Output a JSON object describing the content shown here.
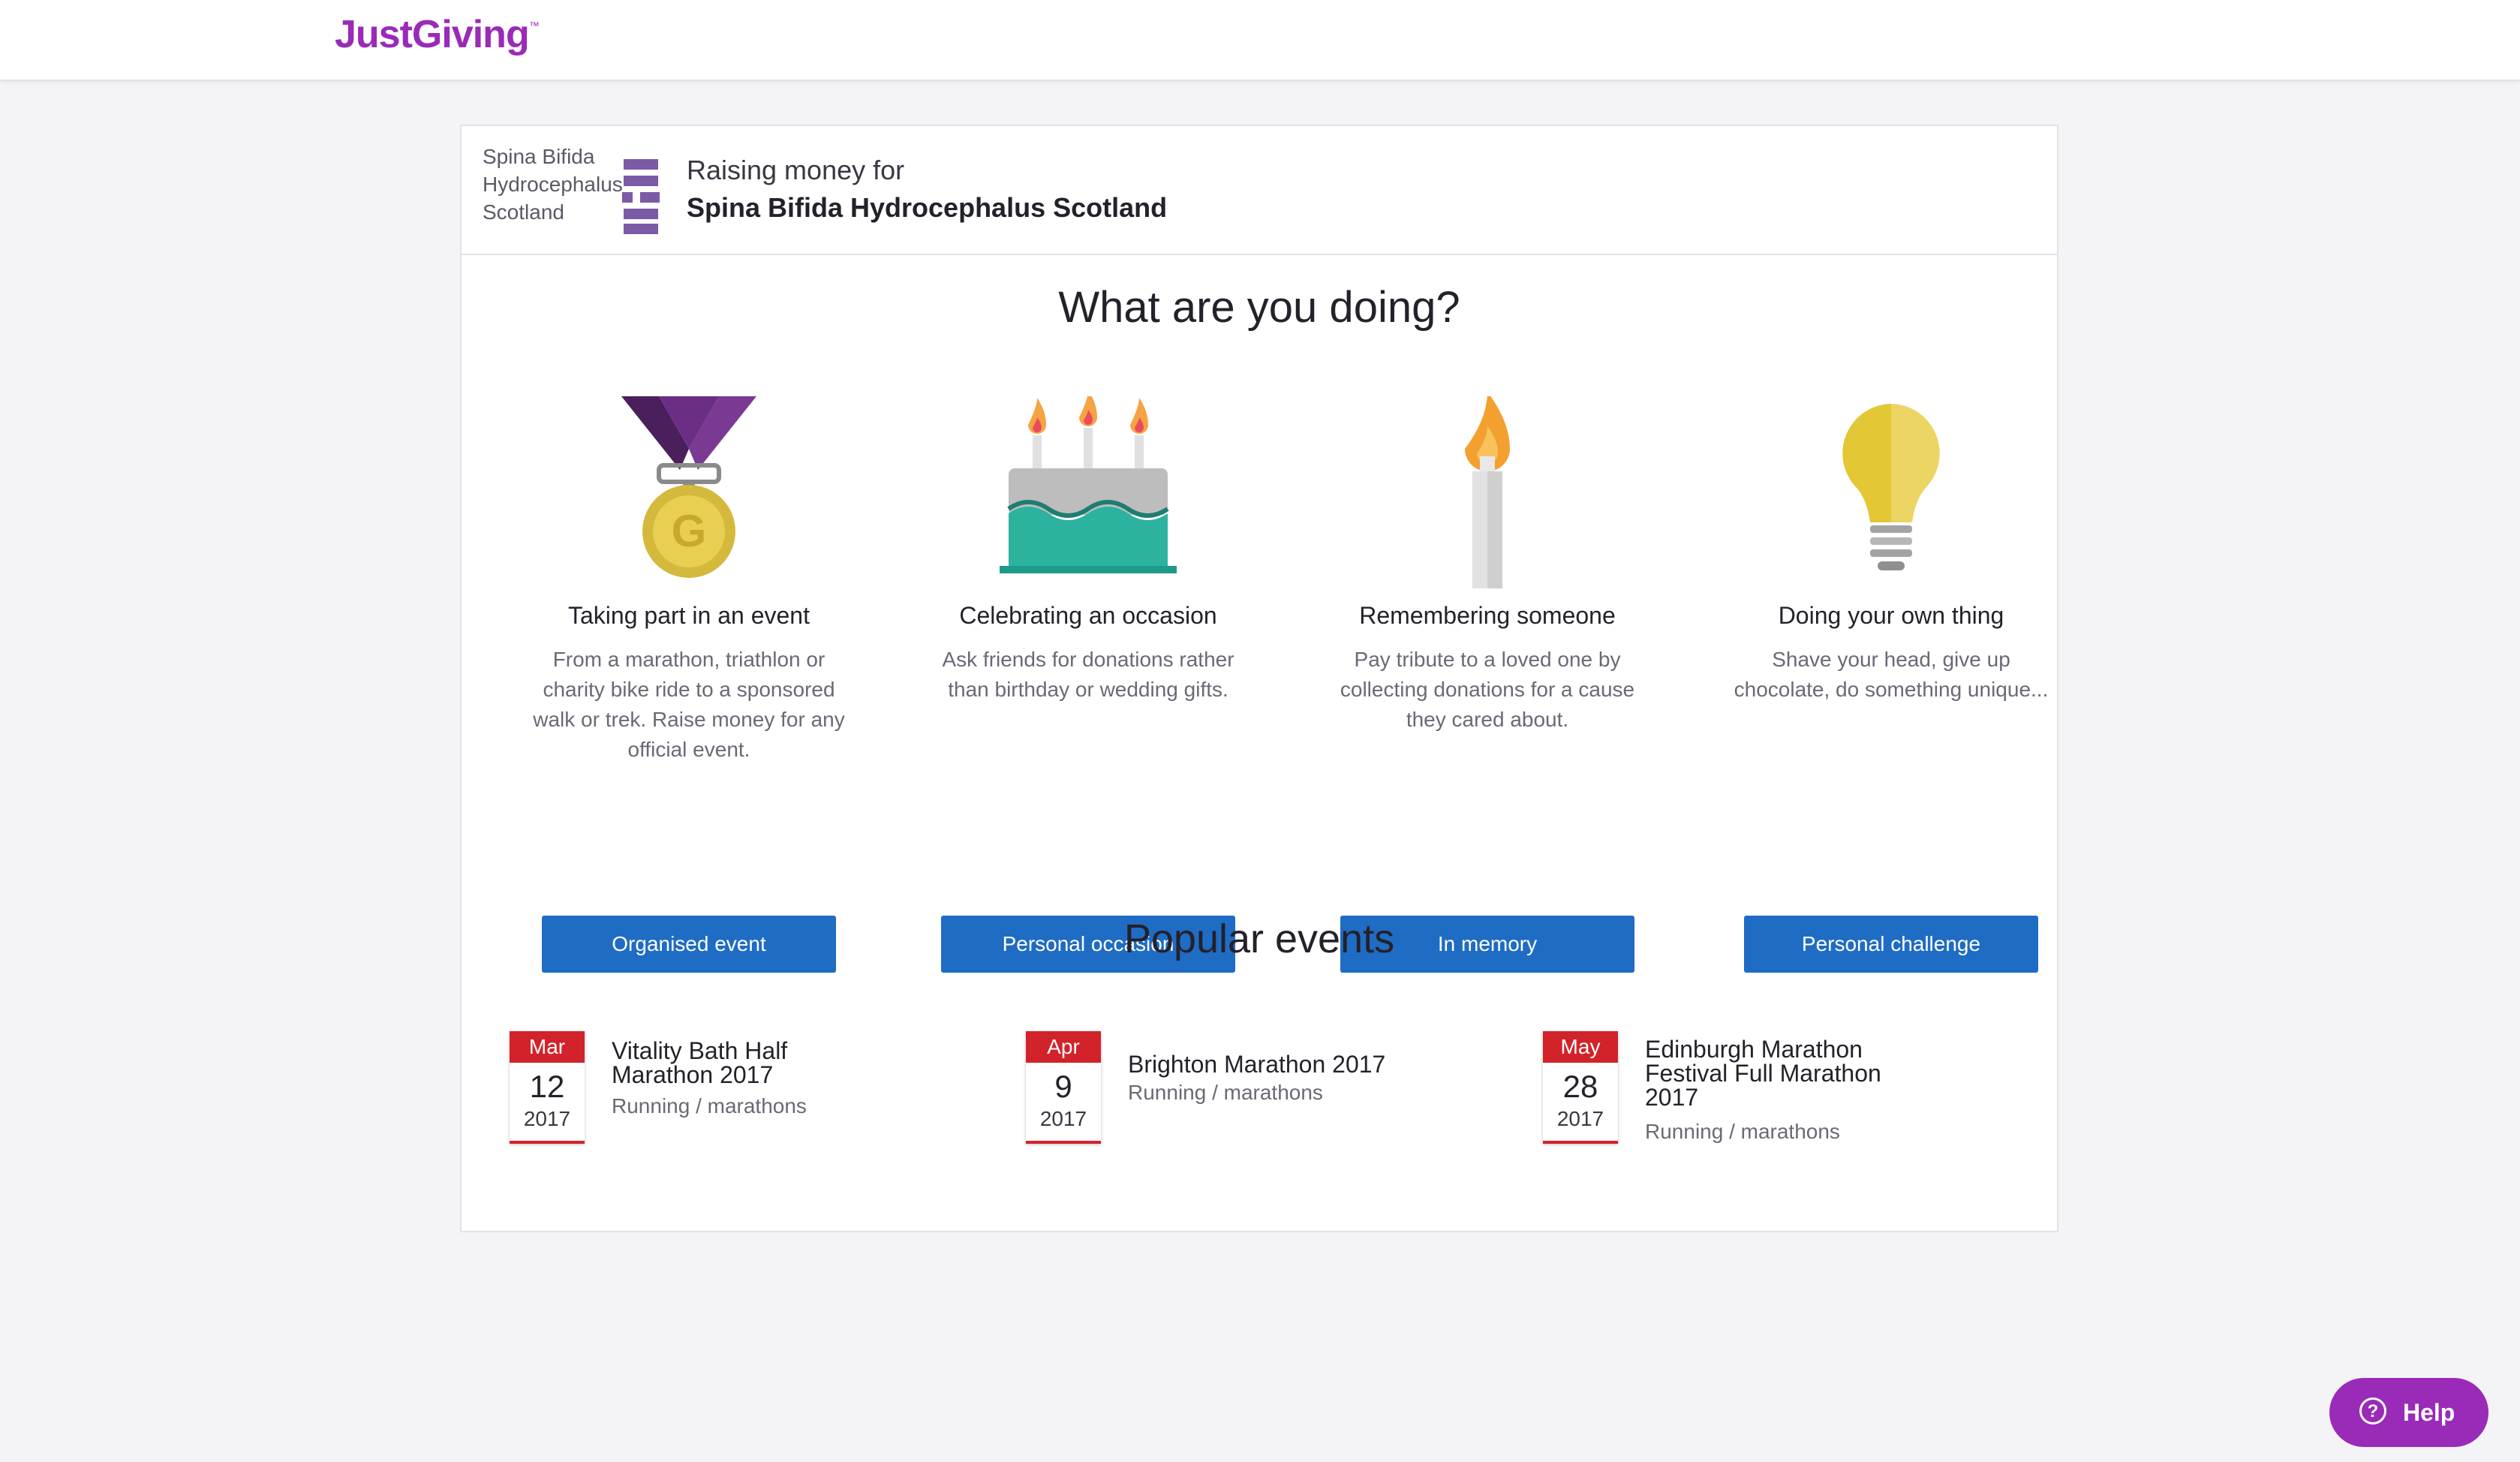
{
  "header": {
    "logo_text": "JustGiving",
    "logo_tm": "™"
  },
  "charity": {
    "logo_lines": [
      "Spina Bifida",
      "Hydrocephalus",
      "Scotland"
    ],
    "raising_label": "Raising money for",
    "name": "Spina Bifida Hydrocephalus Scotland",
    "brand_color": "#7b5aa6"
  },
  "main": {
    "heading": "What are you doing?",
    "options": [
      {
        "icon": "medal-icon",
        "title": "Taking part in an event",
        "description": "From a marathon, triathlon or charity bike ride to a sponsored walk or trek. Raise money for any official event.",
        "button": "Organised event"
      },
      {
        "icon": "birthday-cake-icon",
        "title": "Celebrating an occasion",
        "description": "Ask friends for donations rather than birthday or wedding gifts.",
        "button": "Personal occasion"
      },
      {
        "icon": "candle-icon",
        "title": "Remembering someone",
        "description": "Pay tribute to a loved one by collecting donations for a cause they cared about.",
        "button": "In memory"
      },
      {
        "icon": "lightbulb-icon",
        "title": "Doing your own thing",
        "description": "Shave your head, give up chocolate, do something unique...",
        "button": "Personal challenge"
      }
    ]
  },
  "popular": {
    "heading": "Popular events",
    "events": [
      {
        "month": "Mar",
        "day": "12",
        "year": "2017",
        "name": "Vitality Bath Half Marathon 2017",
        "category": "Running / marathons"
      },
      {
        "month": "Apr",
        "day": "9",
        "year": "2017",
        "name": "Brighton Marathon 2017",
        "category": "Running / marathons"
      },
      {
        "month": "May",
        "day": "28",
        "year": "2017",
        "name": "Edinburgh Marathon Festival Full Marathon 2017",
        "category": "Running / marathons"
      }
    ]
  },
  "help": {
    "label": "Help",
    "icon": "question-circle-icon"
  },
  "colors": {
    "brand_purple": "#9a2ab8",
    "button_blue": "#1f6cc4",
    "calendar_red": "#d2232a"
  }
}
